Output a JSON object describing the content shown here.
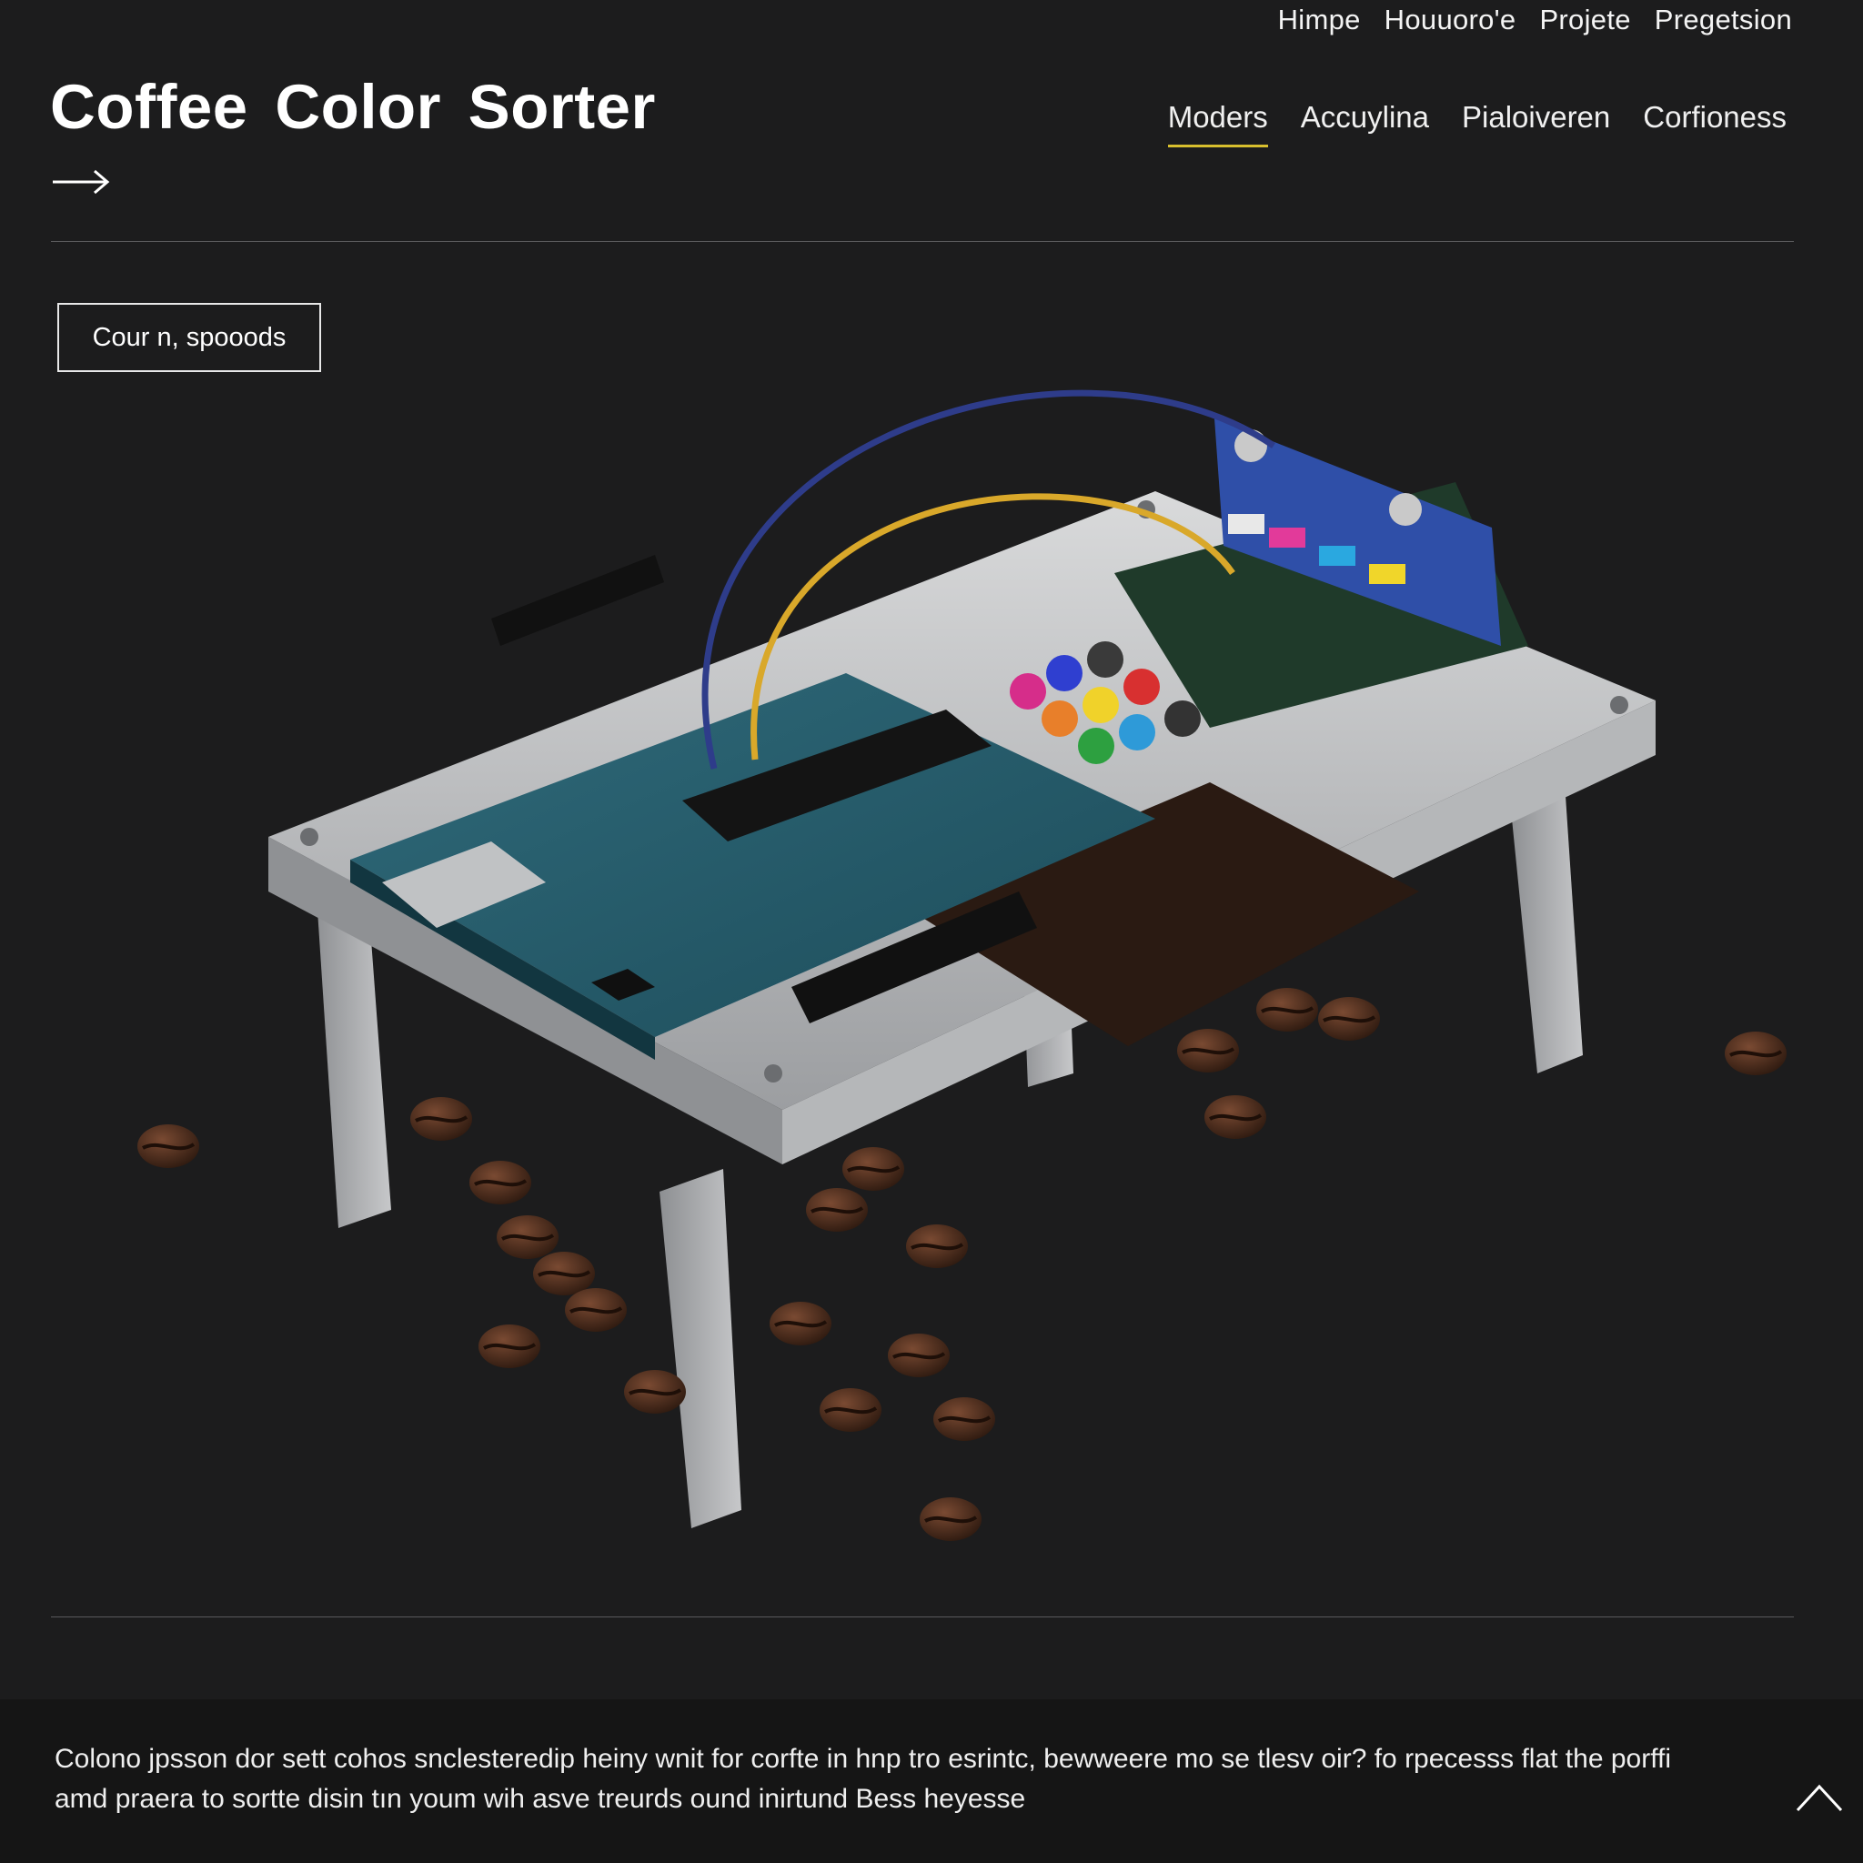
{
  "top_nav": {
    "items": [
      {
        "label": "Himpe"
      },
      {
        "label": "Houuoro'e"
      },
      {
        "label": "Projete"
      },
      {
        "label": "Pregetsion"
      }
    ]
  },
  "header": {
    "title": "Coffee Color Sorter",
    "arrow_icon": "arrow-right-icon"
  },
  "main_nav": {
    "tabs": [
      {
        "label": "Moders",
        "active": true
      },
      {
        "label": "Accuylina",
        "active": false
      },
      {
        "label": "Pialoiveren",
        "active": false
      },
      {
        "label": "Corfioness",
        "active": false
      }
    ]
  },
  "hero": {
    "button_label": "Cour n, spooods",
    "image_subject": "Arduino board with colour sensor on aluminium frame, coffee beans scattered"
  },
  "footer": {
    "text": "Colono jpsson dor sett cohos snclesteredip heiny wnit for corfte in hnp tro esrintc, bewweere mo se tlesv oir? fo rpecesss flat the porffi amd praera to sortte disin tın youm wih asve treurds ound inirtund Bess heyesse",
    "scroll_icon": "chevron-up-icon"
  },
  "colors": {
    "background": "#1c1c1d",
    "accent_underline": "#d8bf2e",
    "rule": "#5a5a5c",
    "footer_band": "#151515"
  }
}
